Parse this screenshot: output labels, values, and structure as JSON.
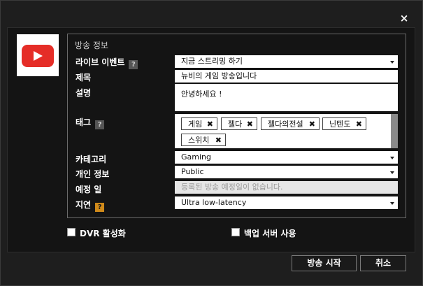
{
  "dialog": {
    "close_label": "×",
    "group_title": "방송 정보",
    "labels": {
      "live_event": "라이브 이벤트",
      "title": "제목",
      "description": "설명",
      "tags": "태그",
      "category": "카테고리",
      "privacy": "개인 정보",
      "schedule": "예정 일",
      "latency": "지연"
    },
    "help_mark": "?",
    "fields": {
      "live_event": "지금 스트리밍 하기",
      "title": "뉴비의 게임 방송입니다",
      "description": "안녕하세요 !",
      "category": "Gaming",
      "privacy": "Public",
      "schedule": "등록된 방송 예정일이 없습니다.",
      "latency": "Ultra low-latency"
    },
    "tags": [
      "게임",
      "젤다",
      "젤다의전설",
      "닌텐도",
      "스위치"
    ],
    "tag_remove_glyph": "✖",
    "checkboxes": {
      "dvr": "DVR 활성화",
      "backup": "백업 서버 사용"
    },
    "buttons": {
      "start": "방송 시작",
      "cancel": "취소"
    }
  }
}
